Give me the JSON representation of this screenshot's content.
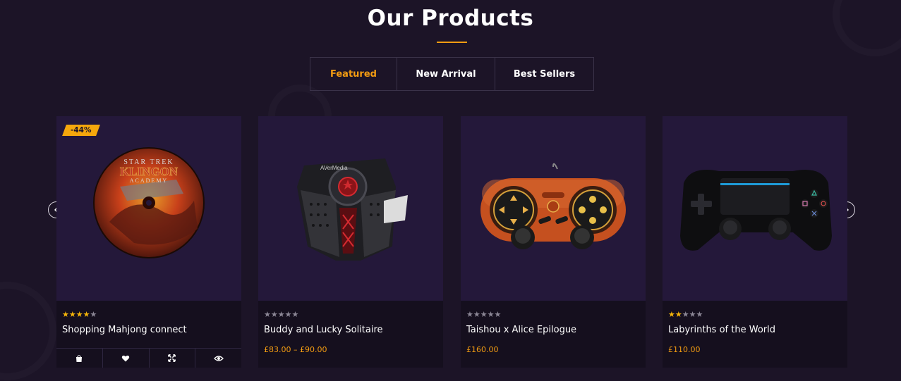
{
  "section": {
    "title": "Our Products"
  },
  "tabs": [
    {
      "label": "Featured",
      "active": true
    },
    {
      "label": "New Arrival",
      "active": false
    },
    {
      "label": "Best Sellers",
      "active": false
    }
  ],
  "products": [
    {
      "name": "Shopping Mahjong connect",
      "rating": 4,
      "price": "",
      "badge": "-44%",
      "image_icon": "dvd-disc-icon"
    },
    {
      "name": "Buddy and Lucky Solitaire",
      "rating": 0,
      "price": "£83.00 – £90.00",
      "badge": "",
      "image_icon": "avermedia-capture-device-icon"
    },
    {
      "name": "Taishou x Alice Epilogue",
      "rating": 0,
      "price": "£160.00",
      "badge": "",
      "image_icon": "orange-gamepad-icon"
    },
    {
      "name": "Labyrinths of the World",
      "rating": 2,
      "price": "£110.00",
      "badge": "",
      "image_icon": "black-gamepad-icon"
    }
  ],
  "disc_text": {
    "line1": "STAR TREK",
    "line2": "KLINGON",
    "line3": "ACADEMY",
    "brand": "AVerMedia"
  },
  "actions": [
    {
      "icon": "shopping-bag-icon"
    },
    {
      "icon": "heart-icon"
    },
    {
      "icon": "expand-icon"
    },
    {
      "icon": "eye-icon"
    }
  ],
  "colors": {
    "background": "#1c1427",
    "accent": "#f39c12",
    "card_image_bg": "#24183a",
    "card_info_bg": "#150f1e"
  }
}
